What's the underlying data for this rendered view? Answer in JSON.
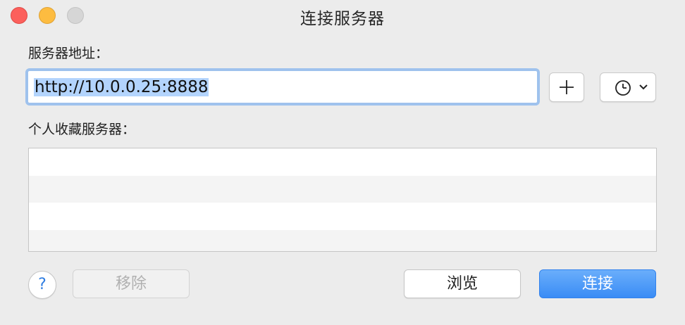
{
  "window": {
    "title": "连接服务器"
  },
  "address": {
    "label": "服务器地址：",
    "value": "http://10.0.0.25:8888"
  },
  "favorites": {
    "label": "个人收藏服务器：",
    "rows": [
      "",
      "",
      "",
      ""
    ]
  },
  "buttons": {
    "help_label": "?",
    "remove_label": "移除",
    "browse_label": "浏览",
    "connect_label": "连接"
  },
  "icons": {
    "add": "plus-icon",
    "history": "clock-icon",
    "dropdown": "chevron-down-icon"
  },
  "colors": {
    "accent": "#3a8cf5",
    "focus_ring": "#9fc2ed",
    "selection": "#b3d4fd",
    "close": "#fc605c",
    "minimize": "#fdbc40",
    "zoom_disabled": "#d6d6d6"
  }
}
